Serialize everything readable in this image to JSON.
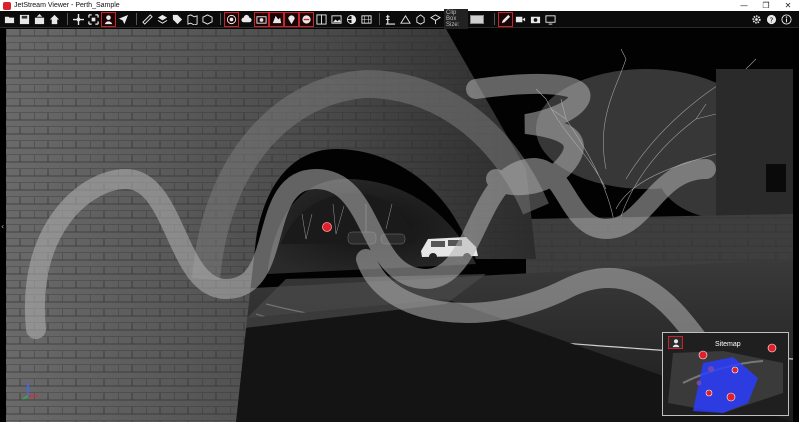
{
  "window": {
    "title": "JetStream Viewer - Perth_Sample",
    "minimize_glyph": "—",
    "maximize_glyph": "❐",
    "close_glyph": "✕"
  },
  "toolbar": {
    "clip_box_label": "Clip Box Size:",
    "icons": [
      "open-folder-icon",
      "save-icon",
      "export-icon",
      "home-icon",
      "navigate-icon",
      "fit-view-icon",
      "walk-mode-icon",
      "fly-mode-icon",
      "measure-icon",
      "layers-icon",
      "tag-icon",
      "map-icon",
      "cube-icon",
      "target-icon",
      "cloud-icon",
      "capture-icon",
      "location-icon",
      "pin-icon",
      "pano-icon",
      "split-view-icon",
      "photo-icon",
      "sphere-icon",
      "grid-icon",
      "elevation-icon",
      "dimension-icon",
      "clip-icon",
      "box-icon",
      "pencil-icon",
      "video-icon",
      "camera-icon",
      "screen-icon",
      "gear-icon",
      "help-icon",
      "info-icon"
    ]
  },
  "sitemap": {
    "title": "Sitemap"
  },
  "colors": {
    "accent": "#c9232b",
    "sitemap_blue": "#2a3dff",
    "scan_marker": "#e0202a"
  }
}
